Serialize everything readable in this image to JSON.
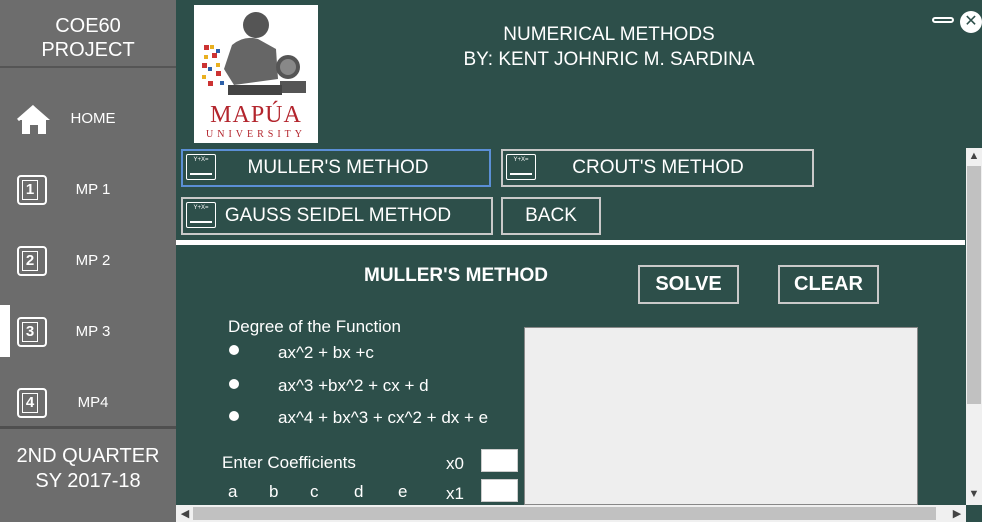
{
  "sidebar": {
    "title_line1": "COE60",
    "title_line2": "PROJECT",
    "items": [
      {
        "label": "HOME",
        "icon": "home-icon"
      },
      {
        "label": "MP 1",
        "icon": "number-1-icon",
        "num": "1"
      },
      {
        "label": "MP 2",
        "icon": "number-2-icon",
        "num": "2"
      },
      {
        "label": "MP 3",
        "icon": "number-3-icon",
        "num": "3"
      },
      {
        "label": "MP4",
        "icon": "number-4-icon",
        "num": "4"
      }
    ],
    "active_item": "MP 3",
    "footer_line1": "2ND QUARTER",
    "footer_line2": "SY 2017-18"
  },
  "header": {
    "logo_text": "MAPÚA",
    "logo_subtext": "UNIVERSITY",
    "title": "NUMERICAL METHODS",
    "author": "BY: KENT JOHNRIC M. SARDINA"
  },
  "window_controls": {
    "minimize": "minimize-icon",
    "close": "close-icon",
    "close_glyph": "✕"
  },
  "method_buttons": {
    "muller": "MULLER'S METHOD",
    "crout": "CROUT'S METHOD",
    "gauss": "GAUSS SEIDEL METHOD",
    "back": "BACK",
    "icon_text": "Y+X="
  },
  "section": {
    "title": "MULLER'S METHOD",
    "solve": "SOLVE",
    "clear": "CLEAR"
  },
  "degree": {
    "label": "Degree of the Function",
    "options": [
      "ax^2 + bx +c",
      "ax^3 +bx^2 + cx + d",
      "ax^4 + bx^3 + cx^2  + dx + e"
    ]
  },
  "coefficients": {
    "label": "Enter Coefficients",
    "letters": [
      "a",
      "b",
      "c",
      "d",
      "e"
    ],
    "x_labels": [
      "x0",
      "x1"
    ],
    "x0_value": "",
    "x1_value": ""
  },
  "output": {
    "value": ""
  },
  "colors": {
    "main_bg": "#2d4f4a",
    "sidebar_bg": "#6c6c6c",
    "selected_border": "#5b8fd6",
    "brand_red": "#b3252d"
  }
}
